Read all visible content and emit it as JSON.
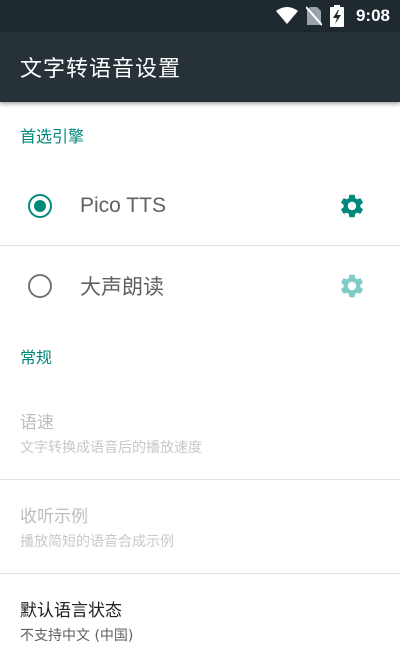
{
  "status_bar": {
    "time": "9:08",
    "icons": [
      "wifi-icon",
      "no-sim-icon",
      "battery-charging-icon"
    ]
  },
  "app_bar": {
    "title": "文字转语音设置"
  },
  "preferred_engine": {
    "header": "首选引擎",
    "engines": [
      {
        "label": "Pico TTS",
        "selected": true,
        "settings_enabled": true
      },
      {
        "label": "大声朗读",
        "selected": false,
        "settings_enabled": false
      }
    ]
  },
  "general": {
    "header": "常规",
    "items": [
      {
        "title": "语速",
        "summary": "文字转换成语音后的播放速度",
        "enabled": false
      },
      {
        "title": "收听示例",
        "summary": "播放简短的语音合成示例",
        "enabled": false
      },
      {
        "title": "默认语言状态",
        "summary": "不支持中文 (中国)",
        "enabled": true
      }
    ]
  },
  "colors": {
    "accent": "#00897b",
    "app_bar": "#263238",
    "status_bar": "#1e2a30"
  }
}
